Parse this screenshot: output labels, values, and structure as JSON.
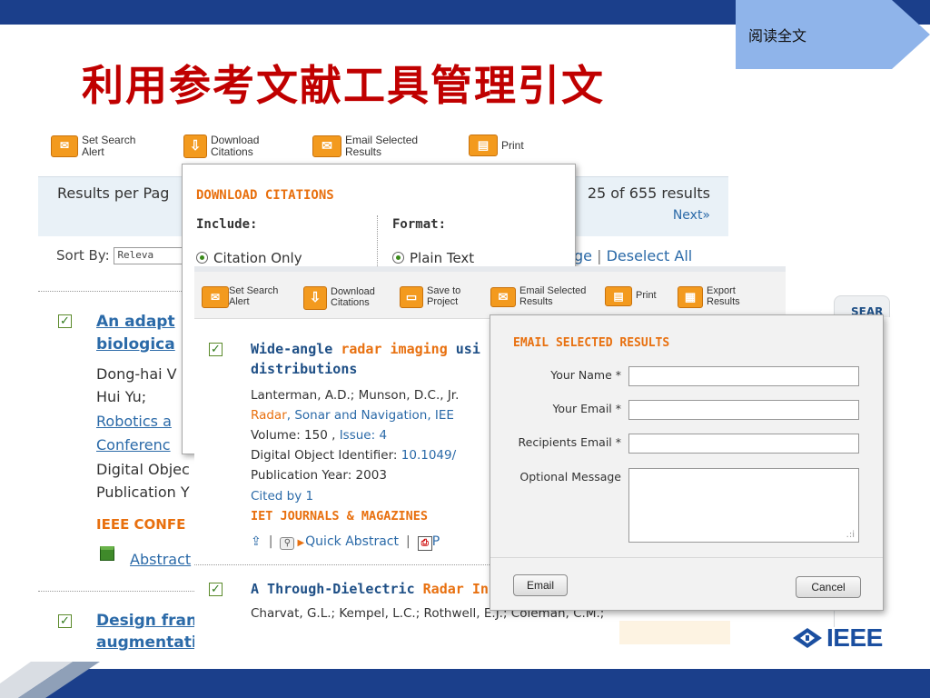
{
  "slide": {
    "title": "利用参考文献工具管理引文",
    "read_tab": "阅读全文"
  },
  "back_toolbar": {
    "set_search_alert": "Set Search Alert",
    "download_citations": "Download Citations",
    "email_selected_results": "Email Selected Results",
    "print": "Print"
  },
  "results": {
    "per_page_label": "Results per Pag",
    "count": "25 of 655 results",
    "next": "Next»",
    "sort_label": "Sort By:",
    "sort_value": "Releva",
    "select_page_fragment": "ge",
    "deselect_all": "Deselect All"
  },
  "back_items": [
    {
      "title_line1": "An adapt",
      "title_line2": "biologica",
      "authors_line1": "Dong-hai V",
      "authors_line2": "Hui Yu;",
      "pub_link1": "Robotics a",
      "pub_link2": "Conferenc",
      "doi_label": "Digital Objec",
      "year_label": "Publication Y",
      "source": "IEEE CONFE",
      "abstract_link": "Abstract"
    },
    {
      "title_line1": "Design fran",
      "title_line2": "augmentation"
    }
  ],
  "download_popup": {
    "heading": "DOWNLOAD CITATIONS",
    "include_label": "Include:",
    "format_label": "Format:",
    "include_option": "Citation Only",
    "format_option": "Plain Text"
  },
  "front_toolbar": {
    "set_search_alert": "Set Search Alert",
    "download_citations": "Download Citations",
    "save_to_project": "Save to Project",
    "email_selected_results": "Email Selected Results",
    "print": "Print",
    "export_results": "Export Results"
  },
  "front_items": [
    {
      "title_pre": "Wide-angle ",
      "title_hl": "radar imaging",
      "title_post": " usi",
      "title_line2": "distributions",
      "authors": "Lanterman, A.D.; Munson, D.C., Jr.",
      "journal_hl": "Radar",
      "journal_rest": ", Sonar and Navigation, IEE",
      "volume_label": "Volume: 150 , ",
      "issue": "Issue: 4",
      "doi_label": "Digital Object Identifier: ",
      "doi_value": "10.1049/",
      "year": "Publication Year: 2003",
      "cited_by": "Cited by 1",
      "source": "IET JOURNALS & MAGAZINES",
      "quick_abstract": "Quick Abstract",
      "pdf_fragment": "P"
    },
    {
      "title_pre": "A Through-Dielectric ",
      "title_hl": "Radar In",
      "authors": "Charvat, G.L.; Kempel, L.C.; Rothwell, E.J.; Coleman, C.M.;"
    }
  ],
  "sidebar": {
    "tab_fragment": "SEAR"
  },
  "email_popup": {
    "heading": "EMAIL SELECTED RESULTS",
    "name_label": "Your Name *",
    "email_label": "Your Email *",
    "recipients_label": "Recipients Email *",
    "message_label": "Optional Message",
    "name_value": "",
    "email_value": "",
    "recipients_value": "",
    "email_button": "Email",
    "cancel_button": "Cancel"
  },
  "logo": {
    "text": "IEEE"
  },
  "colors": {
    "title_red": "#c00000",
    "frame_blue": "#1b3f8b",
    "accent_orange": "#e8700f",
    "link_blue": "#2b6aa8"
  }
}
